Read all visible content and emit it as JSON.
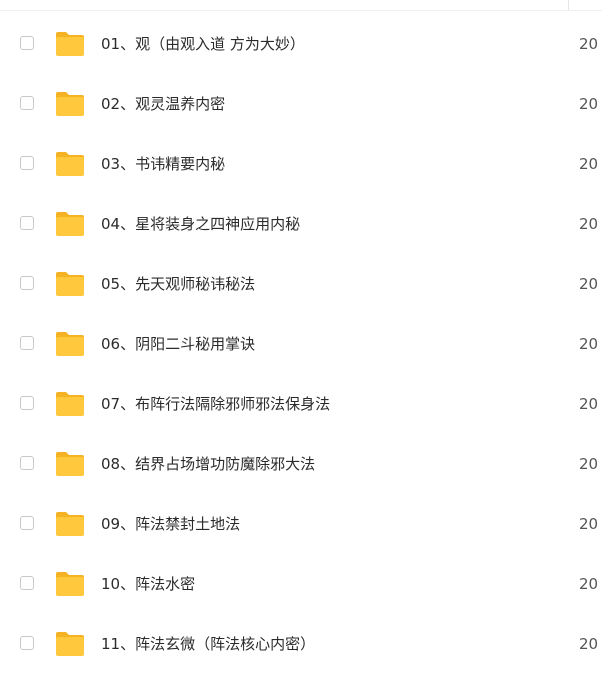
{
  "colors": {
    "folder": "#FFC83D",
    "folder_tab": "#F5B324",
    "checkbox_border": "#C9C9C9",
    "text": "#2B2B2B",
    "date_text": "#555555"
  },
  "files": [
    {
      "name": "01、观（由观入道 方为大妙）",
      "date": "20",
      "icon": "folder-icon"
    },
    {
      "name": "02、观灵温养内密",
      "date": "20",
      "icon": "folder-icon"
    },
    {
      "name": "03、书讳精要内秘",
      "date": "20",
      "icon": "folder-icon"
    },
    {
      "name": "04、星将装身之四神应用内秘",
      "date": "20",
      "icon": "folder-icon"
    },
    {
      "name": "05、先天观师秘讳秘法",
      "date": "20",
      "icon": "folder-icon"
    },
    {
      "name": "06、阴阳二斗秘用掌诀",
      "date": "20",
      "icon": "folder-icon"
    },
    {
      "name": "07、布阵行法隔除邪师邪法保身法",
      "date": "20",
      "icon": "folder-icon"
    },
    {
      "name": "08、结界占场增功防魔除邪大法",
      "date": "20",
      "icon": "folder-icon"
    },
    {
      "name": "09、阵法禁封土地法",
      "date": "20",
      "icon": "folder-icon"
    },
    {
      "name": "10、阵法水密",
      "date": "20",
      "icon": "folder-icon"
    },
    {
      "name": "11、阵法玄微（阵法核心内密）",
      "date": "20",
      "icon": "folder-icon"
    }
  ]
}
